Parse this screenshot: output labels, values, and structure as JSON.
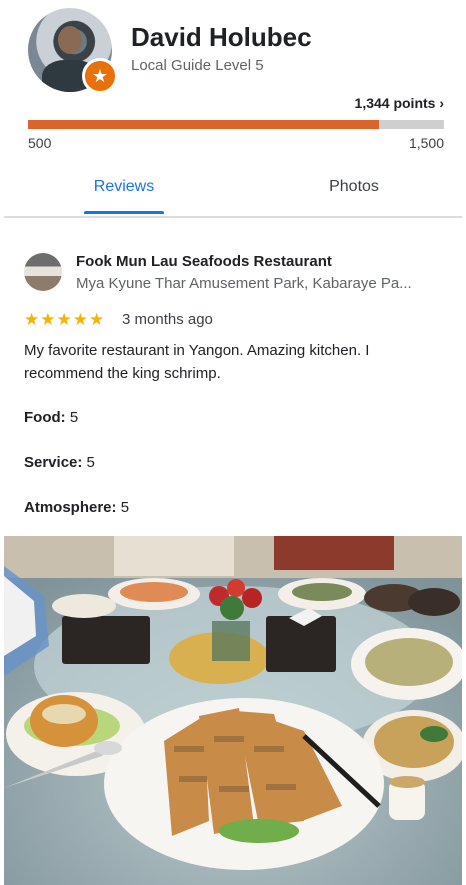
{
  "profile": {
    "name": "David Holubec",
    "level": "Local Guide Level 5",
    "points_label": "1,344 points ›",
    "points": 1344,
    "progress_min_label": "500",
    "progress_max_label": "1,500",
    "progress_fraction": 0.844,
    "accent_color": "#d9652b"
  },
  "tabs": [
    {
      "label": "Reviews",
      "selected": true
    },
    {
      "label": "Photos",
      "selected": false
    }
  ],
  "review": {
    "place_name": "Fook Mun Lau Seafoods Restaurant",
    "place_address": "Mya Kyune Thar Amusement Park, Kabaraye Pa...",
    "stars": "★★★★★",
    "rating": 5,
    "time_ago": "3 months ago",
    "text": "My favorite restaurant in Yangon. Amazing kitchen. I recommend the king schrimp.",
    "attributes": [
      {
        "label": "Food:",
        "value": "5"
      },
      {
        "label": "Service:",
        "value": "5"
      },
      {
        "label": "Atmosphere:",
        "value": "5"
      }
    ]
  },
  "icons": {
    "badge": "star-badge-icon",
    "chevron": "chevron-right-icon"
  }
}
